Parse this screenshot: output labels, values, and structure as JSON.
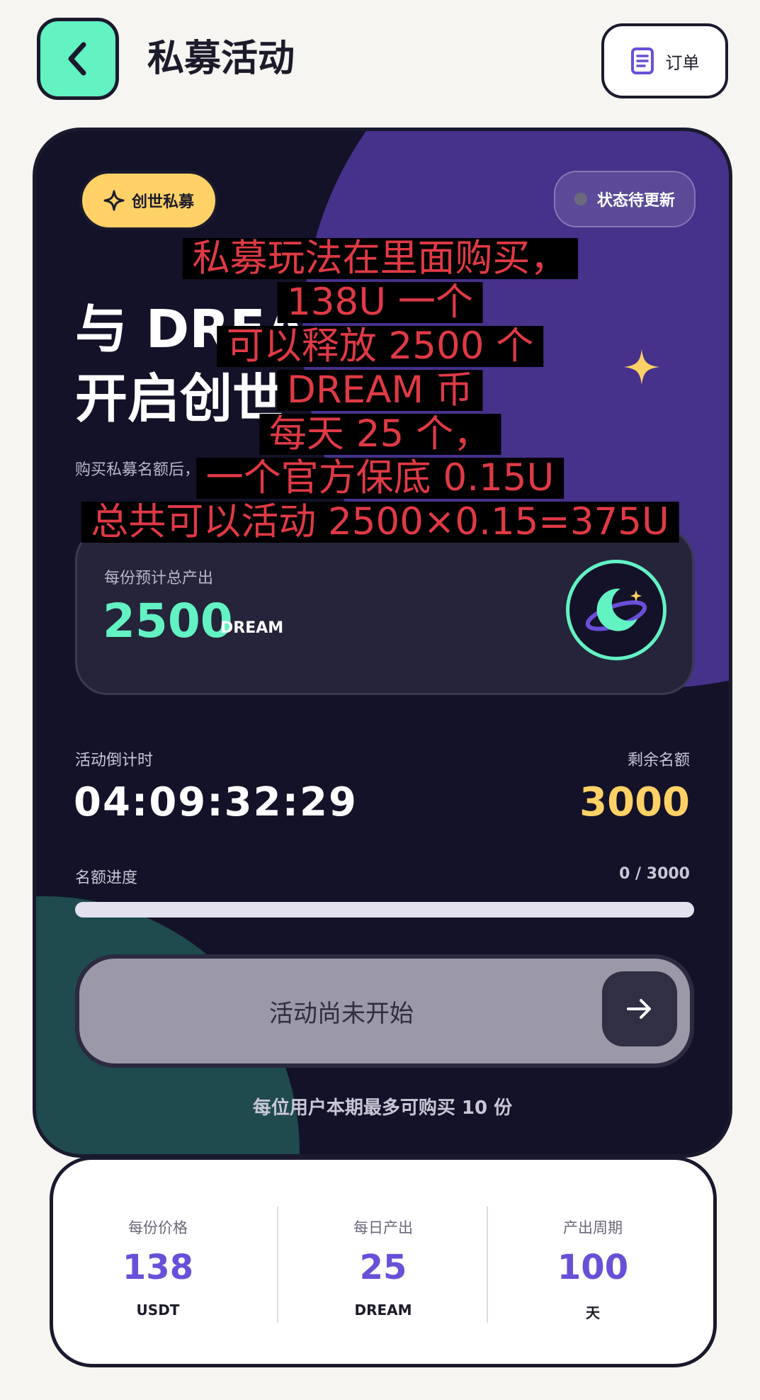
{
  "header": {
    "title": "私募活动",
    "orders_label": "订单"
  },
  "card": {
    "badge_label": "创世私募",
    "status_label": "状态待更新",
    "headline_line1": "与 DREA",
    "headline_line2": "开启创世",
    "subtitle": "购买私募名额后，DRE",
    "output": {
      "label": "每份预计总产出",
      "value": "2500",
      "unit": "DREAM"
    },
    "countdown": {
      "label": "活动倒计时",
      "value": "04:09:32:29"
    },
    "remaining": {
      "label": "剩余名额",
      "value": "3000"
    },
    "progress": {
      "label": "名额进度",
      "count_text": "0 / 3000",
      "fraction": 0
    },
    "cta_label": "活动尚未开始",
    "limit_note": "每位用户本期最多可购买 10 份"
  },
  "stats": [
    {
      "label": "每份价格",
      "value": "138",
      "unit": "USDT"
    },
    {
      "label": "每日产出",
      "value": "25",
      "unit": "DREAM"
    },
    {
      "label": "产出周期",
      "value": "100",
      "unit": "天"
    }
  ],
  "overlay_text": [
    "私募玩法在里面购买，",
    "138U 一个",
    "可以释放 2500 个",
    "DREAM 币",
    "每天 25 个，",
    "一个官方保底 0.15U",
    "总共可以活动 2500×0.15=375U"
  ],
  "colors": {
    "accent_mint": "#63f2c2",
    "accent_yellow": "#ffd166",
    "accent_purple": "#6a4fd8",
    "card_bg": "#131228",
    "overlay_text": "#e03a45"
  },
  "icons": {
    "back": "chevron-left-icon",
    "orders": "document-icon",
    "badge": "sparkle-icon",
    "moon": "moon-planet-icon",
    "cta": "arrow-right-icon"
  }
}
